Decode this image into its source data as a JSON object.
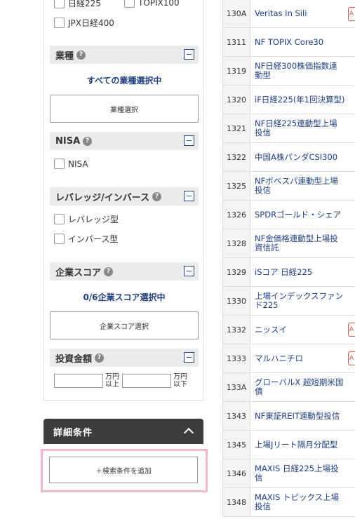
{
  "index_filters": {
    "nikkei225": "日経225",
    "topix100": "TOPIX100",
    "jpx400": "JPX日経400"
  },
  "industry": {
    "title": "業種",
    "selected_text": "すべての業種選択中",
    "button": "業種選択"
  },
  "nisa": {
    "title": "NISA",
    "option": "NISA"
  },
  "leverage": {
    "title": "レバレッジ/インバース",
    "option1": "レバレッジ型",
    "option2": "インバース型"
  },
  "company_score": {
    "title": "企業スコア",
    "selected_text": "0/6企業スコア選択中",
    "button": "企業スコア選択"
  },
  "investment": {
    "title": "投資金額",
    "unit_min_1": "万円",
    "unit_min_2": "以上",
    "unit_max_1": "万円",
    "unit_max_2": "以下"
  },
  "detail": {
    "title": "詳細条件",
    "add_button": "＋検索条件を追加"
  },
  "stocks": [
    {
      "code": "130A",
      "name": "Veritas In Sili",
      "badge": "A"
    },
    {
      "code": "1311",
      "name": "NF TOPIX Core30",
      "badge": ""
    },
    {
      "code": "1319",
      "name": "NF日経300株価指数連動型",
      "badge": ""
    },
    {
      "code": "1320",
      "name": "iF日経225(年1回決算型)",
      "badge": ""
    },
    {
      "code": "1321",
      "name": "NF日経225連動型上場投信",
      "badge": ""
    },
    {
      "code": "1322",
      "name": "中国A株パンダCSI300",
      "badge": ""
    },
    {
      "code": "1325",
      "name": "NFボベスパ連動型上場投信",
      "badge": ""
    },
    {
      "code": "1326",
      "name": "SPDRゴールド・シェア",
      "badge": ""
    },
    {
      "code": "1328",
      "name": "NF金価格連動型上場投資信託",
      "badge": ""
    },
    {
      "code": "1329",
      "name": "iSコア 日経225",
      "badge": ""
    },
    {
      "code": "1330",
      "name": "上場インデックスファンド225",
      "badge": ""
    },
    {
      "code": "1332",
      "name": "ニッスイ",
      "badge": "A"
    },
    {
      "code": "1333",
      "name": "マルハニチロ",
      "badge": "A"
    },
    {
      "code": "133A",
      "name": "グローバルX 超短期米国債",
      "badge": ""
    },
    {
      "code": "1343",
      "name": "NF東証REIT連動型投信",
      "badge": ""
    },
    {
      "code": "1345",
      "name": "上場Jリート隔月分配型",
      "badge": ""
    },
    {
      "code": "1346",
      "name": "MAXIS 日経225上場投信",
      "badge": ""
    },
    {
      "code": "1348",
      "name": "MAXIS トピックス上場投信",
      "badge": ""
    }
  ]
}
